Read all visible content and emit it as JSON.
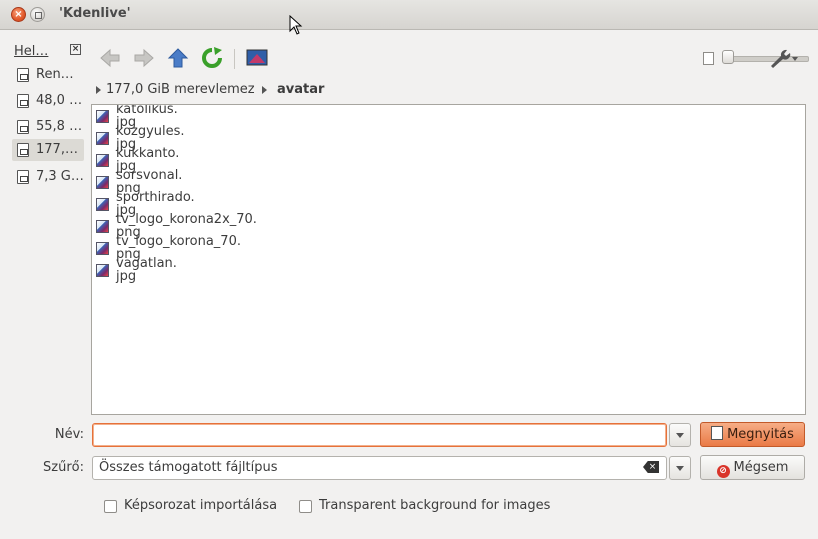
{
  "window": {
    "title": "'Kdenlive'"
  },
  "places": {
    "header": "Hel…",
    "items": [
      {
        "label": "Ren…"
      },
      {
        "label": "48,0 …"
      },
      {
        "label": "55,8 …"
      },
      {
        "label": "177,…"
      },
      {
        "label": "7,3 G…"
      }
    ]
  },
  "toolbar": {
    "icons": [
      "back-arrow-icon",
      "forward-arrow-icon",
      "up-arrow-icon",
      "reload-icon",
      "image-preview-icon",
      "zoom-slider",
      "settings-wrench-icon"
    ],
    "zoom_level": 0.0
  },
  "breadcrumb": {
    "items": [
      "177,0 GiB merevlemez",
      "avatar"
    ]
  },
  "files": [
    {
      "l1": "katolikus.",
      "l2": "jpg"
    },
    {
      "l1": "kozgyules.",
      "l2": "jpg"
    },
    {
      "l1": "kukkanto.",
      "l2": "jpg"
    },
    {
      "l1": "sorsvonal.",
      "l2": "png"
    },
    {
      "l1": "sporthirado.",
      "l2": "jpg"
    },
    {
      "l1": "tv_logo_korona2x_70.",
      "l2": "png"
    },
    {
      "l1": "tv_logo_korona_70.",
      "l2": "png"
    },
    {
      "l1": "vagatlan.",
      "l2": "jpg"
    }
  ],
  "form": {
    "name_label": "Név:",
    "name_value": "",
    "filter_label": "Szűrő:",
    "filter_value": "Összes támogatott fájltípus",
    "open_button": "Megnyitás",
    "cancel_button": "Mégsem",
    "check_sequence": "Képsorozat importálása",
    "check_transparent": "Transparent background for images"
  },
  "colors": {
    "accent": "#e6713a"
  }
}
